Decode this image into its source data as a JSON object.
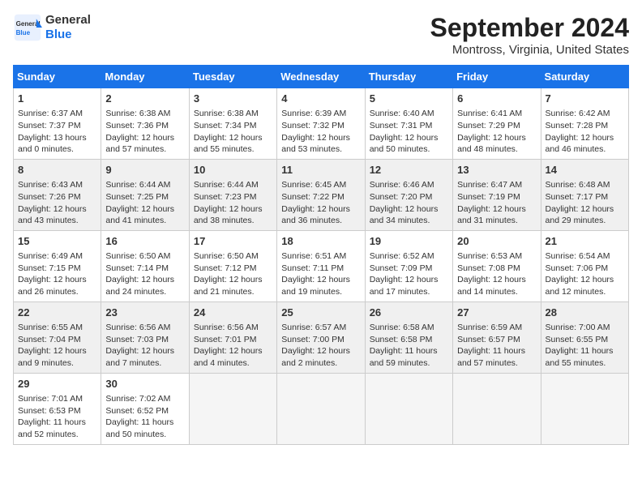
{
  "logo": {
    "line1": "General",
    "line2": "Blue"
  },
  "title": "September 2024",
  "subtitle": "Montross, Virginia, United States",
  "days_header": [
    "Sunday",
    "Monday",
    "Tuesday",
    "Wednesday",
    "Thursday",
    "Friday",
    "Saturday"
  ],
  "weeks": [
    [
      {
        "num": "1",
        "info": "Sunrise: 6:37 AM\nSunset: 7:37 PM\nDaylight: 13 hours\nand 0 minutes."
      },
      {
        "num": "2",
        "info": "Sunrise: 6:38 AM\nSunset: 7:36 PM\nDaylight: 12 hours\nand 57 minutes."
      },
      {
        "num": "3",
        "info": "Sunrise: 6:38 AM\nSunset: 7:34 PM\nDaylight: 12 hours\nand 55 minutes."
      },
      {
        "num": "4",
        "info": "Sunrise: 6:39 AM\nSunset: 7:32 PM\nDaylight: 12 hours\nand 53 minutes."
      },
      {
        "num": "5",
        "info": "Sunrise: 6:40 AM\nSunset: 7:31 PM\nDaylight: 12 hours\nand 50 minutes."
      },
      {
        "num": "6",
        "info": "Sunrise: 6:41 AM\nSunset: 7:29 PM\nDaylight: 12 hours\nand 48 minutes."
      },
      {
        "num": "7",
        "info": "Sunrise: 6:42 AM\nSunset: 7:28 PM\nDaylight: 12 hours\nand 46 minutes."
      }
    ],
    [
      {
        "num": "8",
        "info": "Sunrise: 6:43 AM\nSunset: 7:26 PM\nDaylight: 12 hours\nand 43 minutes."
      },
      {
        "num": "9",
        "info": "Sunrise: 6:44 AM\nSunset: 7:25 PM\nDaylight: 12 hours\nand 41 minutes."
      },
      {
        "num": "10",
        "info": "Sunrise: 6:44 AM\nSunset: 7:23 PM\nDaylight: 12 hours\nand 38 minutes."
      },
      {
        "num": "11",
        "info": "Sunrise: 6:45 AM\nSunset: 7:22 PM\nDaylight: 12 hours\nand 36 minutes."
      },
      {
        "num": "12",
        "info": "Sunrise: 6:46 AM\nSunset: 7:20 PM\nDaylight: 12 hours\nand 34 minutes."
      },
      {
        "num": "13",
        "info": "Sunrise: 6:47 AM\nSunset: 7:19 PM\nDaylight: 12 hours\nand 31 minutes."
      },
      {
        "num": "14",
        "info": "Sunrise: 6:48 AM\nSunset: 7:17 PM\nDaylight: 12 hours\nand 29 minutes."
      }
    ],
    [
      {
        "num": "15",
        "info": "Sunrise: 6:49 AM\nSunset: 7:15 PM\nDaylight: 12 hours\nand 26 minutes."
      },
      {
        "num": "16",
        "info": "Sunrise: 6:50 AM\nSunset: 7:14 PM\nDaylight: 12 hours\nand 24 minutes."
      },
      {
        "num": "17",
        "info": "Sunrise: 6:50 AM\nSunset: 7:12 PM\nDaylight: 12 hours\nand 21 minutes."
      },
      {
        "num": "18",
        "info": "Sunrise: 6:51 AM\nSunset: 7:11 PM\nDaylight: 12 hours\nand 19 minutes."
      },
      {
        "num": "19",
        "info": "Sunrise: 6:52 AM\nSunset: 7:09 PM\nDaylight: 12 hours\nand 17 minutes."
      },
      {
        "num": "20",
        "info": "Sunrise: 6:53 AM\nSunset: 7:08 PM\nDaylight: 12 hours\nand 14 minutes."
      },
      {
        "num": "21",
        "info": "Sunrise: 6:54 AM\nSunset: 7:06 PM\nDaylight: 12 hours\nand 12 minutes."
      }
    ],
    [
      {
        "num": "22",
        "info": "Sunrise: 6:55 AM\nSunset: 7:04 PM\nDaylight: 12 hours\nand 9 minutes."
      },
      {
        "num": "23",
        "info": "Sunrise: 6:56 AM\nSunset: 7:03 PM\nDaylight: 12 hours\nand 7 minutes."
      },
      {
        "num": "24",
        "info": "Sunrise: 6:56 AM\nSunset: 7:01 PM\nDaylight: 12 hours\nand 4 minutes."
      },
      {
        "num": "25",
        "info": "Sunrise: 6:57 AM\nSunset: 7:00 PM\nDaylight: 12 hours\nand 2 minutes."
      },
      {
        "num": "26",
        "info": "Sunrise: 6:58 AM\nSunset: 6:58 PM\nDaylight: 11 hours\nand 59 minutes."
      },
      {
        "num": "27",
        "info": "Sunrise: 6:59 AM\nSunset: 6:57 PM\nDaylight: 11 hours\nand 57 minutes."
      },
      {
        "num": "28",
        "info": "Sunrise: 7:00 AM\nSunset: 6:55 PM\nDaylight: 11 hours\nand 55 minutes."
      }
    ],
    [
      {
        "num": "29",
        "info": "Sunrise: 7:01 AM\nSunset: 6:53 PM\nDaylight: 11 hours\nand 52 minutes."
      },
      {
        "num": "30",
        "info": "Sunrise: 7:02 AM\nSunset: 6:52 PM\nDaylight: 11 hours\nand 50 minutes."
      },
      {
        "num": "",
        "info": ""
      },
      {
        "num": "",
        "info": ""
      },
      {
        "num": "",
        "info": ""
      },
      {
        "num": "",
        "info": ""
      },
      {
        "num": "",
        "info": ""
      }
    ]
  ]
}
